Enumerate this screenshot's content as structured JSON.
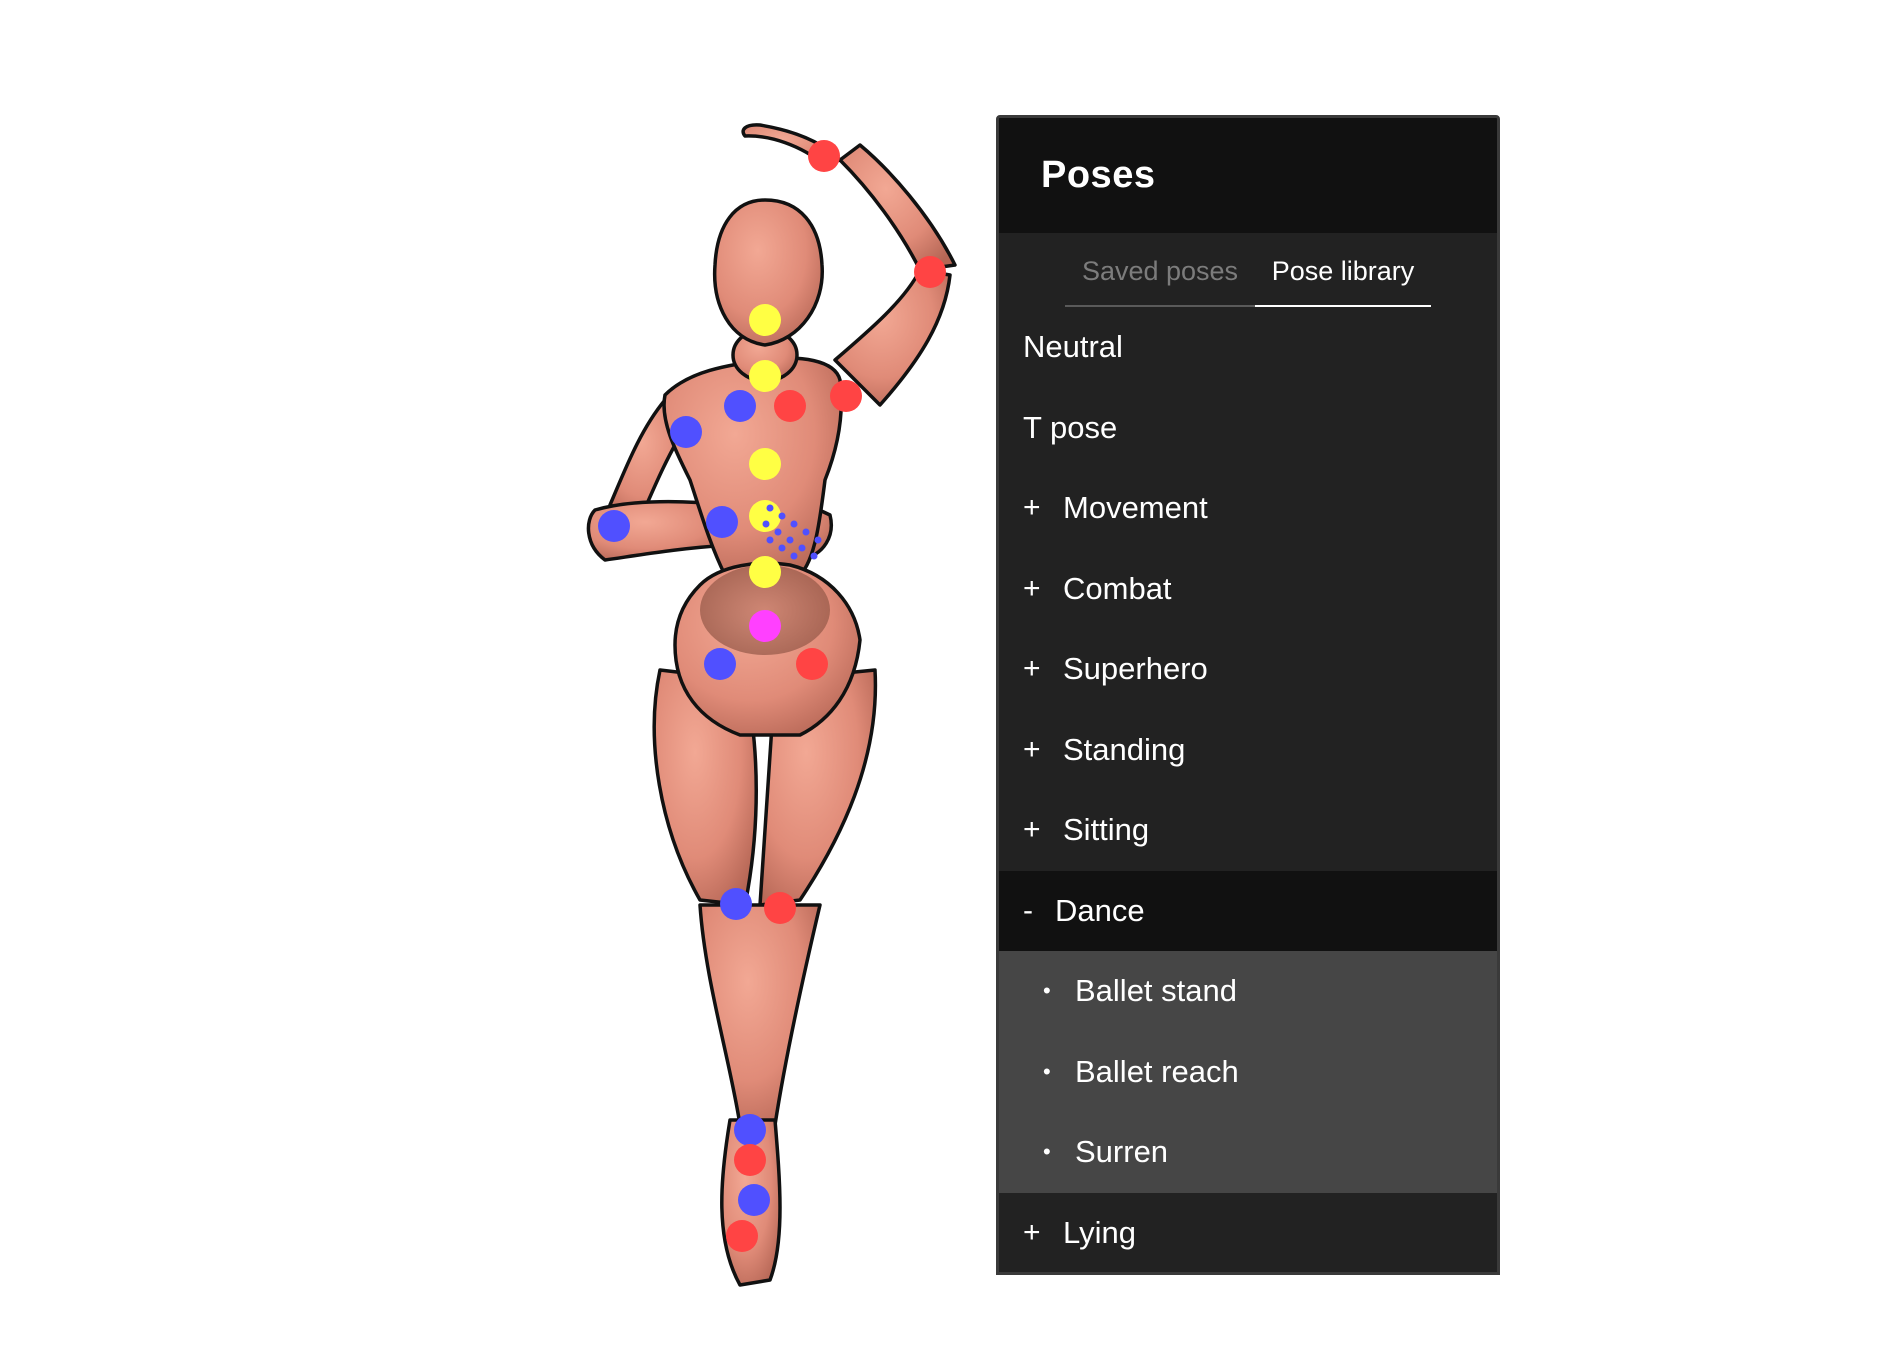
{
  "panel": {
    "title": "Poses",
    "tabs": [
      {
        "label": "Saved poses",
        "active": false
      },
      {
        "label": "Pose library",
        "active": true
      }
    ],
    "items": [
      {
        "label": "Neutral",
        "prefix": ""
      },
      {
        "label": "T pose",
        "prefix": ""
      },
      {
        "label": "Movement",
        "prefix": "+"
      },
      {
        "label": "Combat",
        "prefix": "+"
      },
      {
        "label": "Superhero",
        "prefix": "+"
      },
      {
        "label": "Standing",
        "prefix": "+"
      },
      {
        "label": "Sitting",
        "prefix": "+"
      },
      {
        "label": "Dance",
        "prefix": "-",
        "expanded": true,
        "children": [
          {
            "label": "Ballet stand",
            "bullet": "•"
          },
          {
            "label": "Ballet reach",
            "bullet": "•"
          },
          {
            "label": "Surren",
            "bullet": "•"
          }
        ]
      },
      {
        "label": "Lying",
        "prefix": "+"
      }
    ]
  },
  "colors": {
    "panel_bg": "#222222",
    "panel_header_bg": "#111111",
    "subitem_bg": "#464646",
    "skin": "#e08b78",
    "joint_spine": "#ffff44",
    "joint_left": "#5050ff",
    "joint_right": "#ff4444",
    "joint_root": "#ff40ff"
  }
}
